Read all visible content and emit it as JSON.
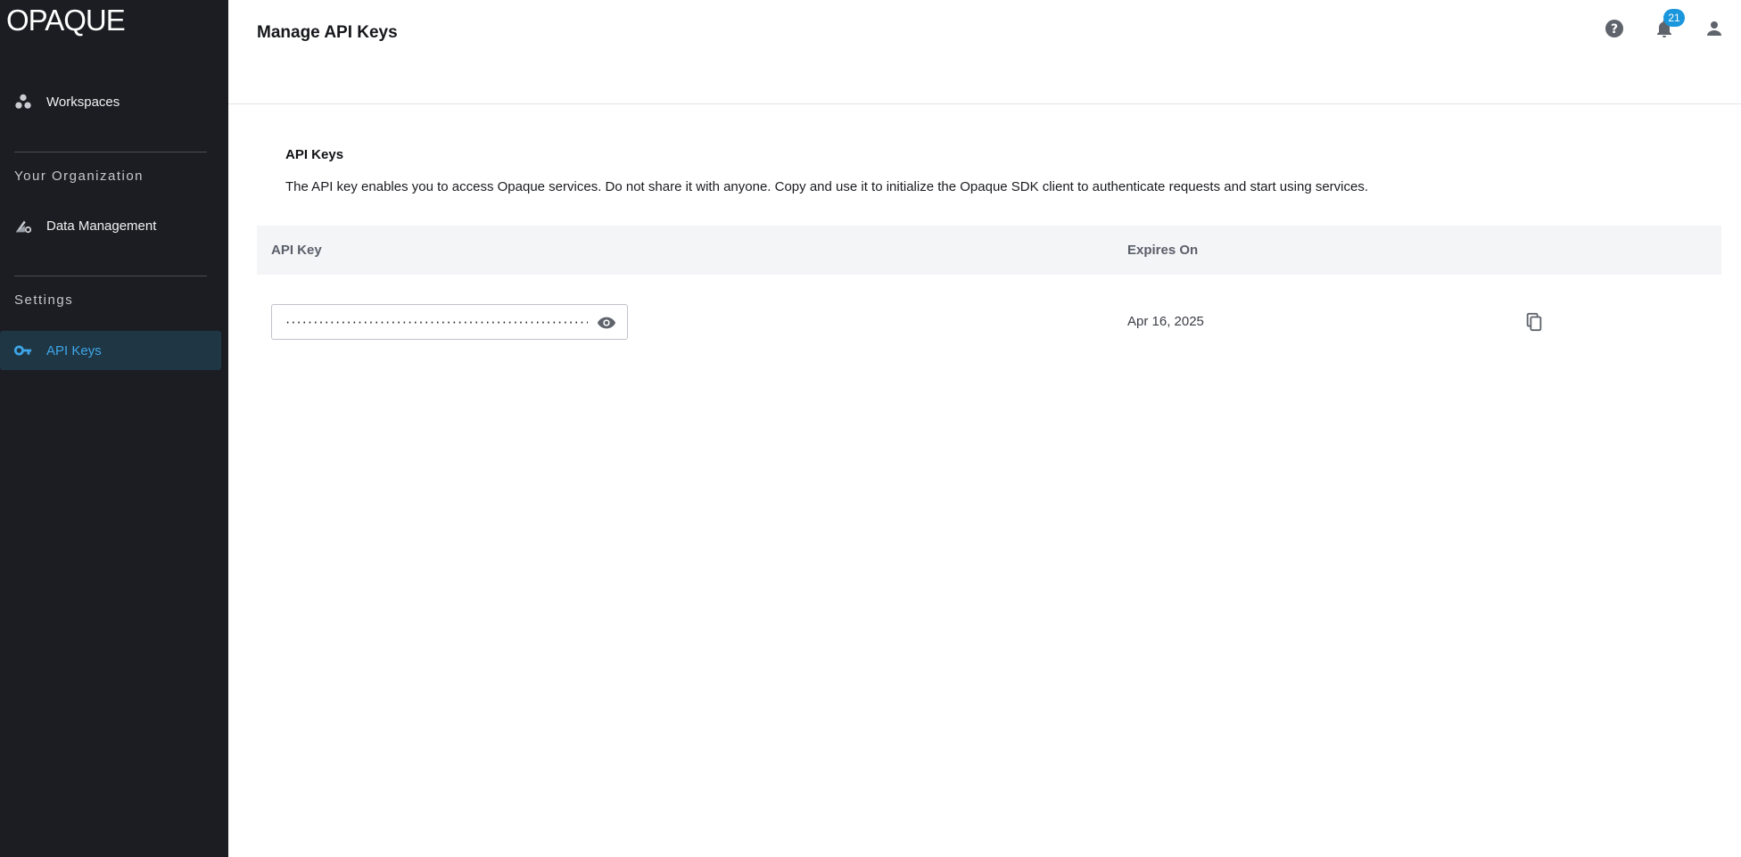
{
  "sidebar": {
    "logo": "OPAQUE",
    "items": [
      {
        "label": "Workspaces",
        "icon": "workspaces-icon"
      },
      {
        "label": "Data Management",
        "icon": "data-management-icon"
      },
      {
        "label": "API Keys",
        "icon": "key-icon",
        "active": true
      }
    ],
    "sections": [
      "Your Organization",
      "Settings"
    ]
  },
  "header": {
    "title": "Manage API Keys",
    "help_icon": "help-icon",
    "notifications_icon": "bell-icon",
    "notifications_count": "21",
    "account_icon": "person-icon"
  },
  "main": {
    "section_title": "API Keys",
    "description": "The API key enables you to access Opaque services. Do not share it with anyone. Copy and use it to initialize the Opaque SDK client to authenticate requests and start using services.",
    "table": {
      "columns": [
        "API Key",
        "Expires On"
      ],
      "rows": [
        {
          "key_masked": "·······································································································",
          "expires_on": "Apr 16, 2025"
        }
      ]
    }
  },
  "colors": {
    "sidebar_bg": "#1b1d22",
    "accent": "#3ea6e8",
    "badge": "#1a96dc"
  }
}
